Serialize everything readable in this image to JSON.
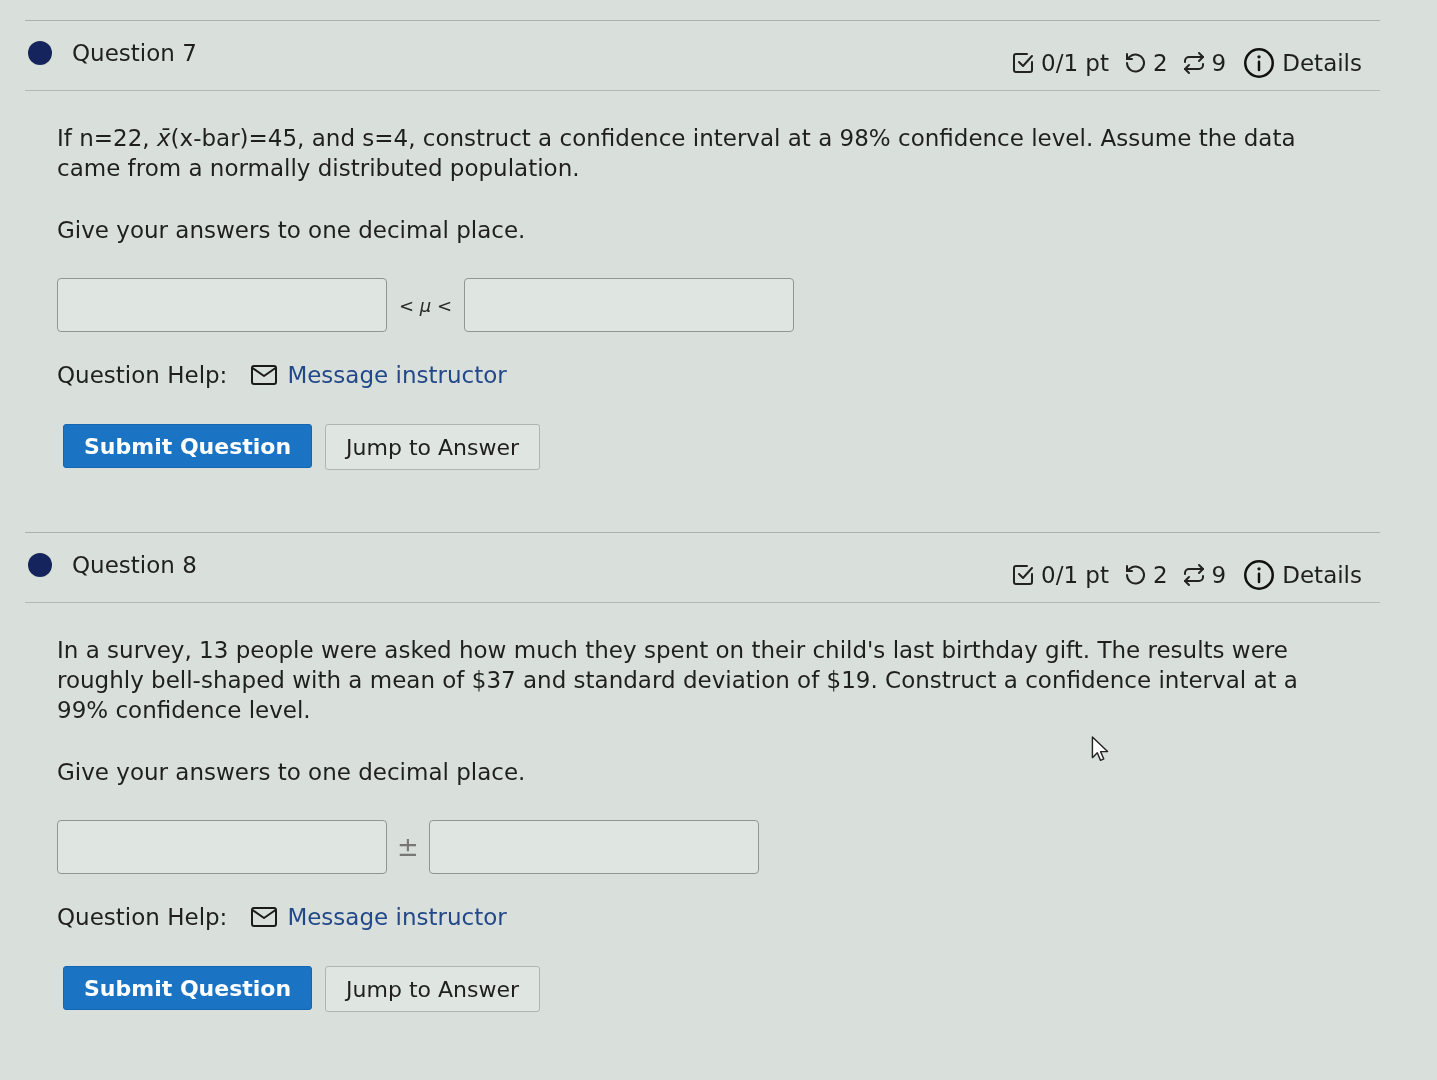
{
  "questions": [
    {
      "title": "Question 7",
      "score": "0/1 pt",
      "retries": "2",
      "attempts": "9",
      "details": "Details",
      "prompt": "If n=22, *x̄*(x-bar)=45, and s=4, construct a confidence interval at a 98% confidence level. Assume the data came from a normally distributed population.",
      "instruction": "Give your answers to one decimal place.",
      "answer": {
        "kind": "interval",
        "separator": "< *μ* <"
      },
      "help_label": "Question Help:",
      "help_link": "Message instructor",
      "buttons": [
        {
          "kind": "primary",
          "label": "Submit Question"
        },
        {
          "kind": "secondary",
          "label": "Jump to Answer"
        }
      ]
    },
    {
      "title": "Question 8",
      "score": "0/1 pt",
      "retries": "2",
      "attempts": "9",
      "details": "Details",
      "prompt": "In a survey, 13 people were asked how much they spent on their child's last birthday gift. The results were roughly bell-shaped with a mean of $37 and standard deviation of $19. Construct a confidence interval at a 99% confidence level.",
      "instruction": "Give your answers to one decimal place.",
      "answer": {
        "kind": "plus_minus",
        "separator": "±"
      },
      "help_label": "Question Help:",
      "help_link": "Message instructor",
      "buttons": [
        {
          "kind": "primary",
          "label": "Submit Question"
        },
        {
          "kind": "secondary",
          "label": "Jump to Answer"
        }
      ]
    }
  ]
}
